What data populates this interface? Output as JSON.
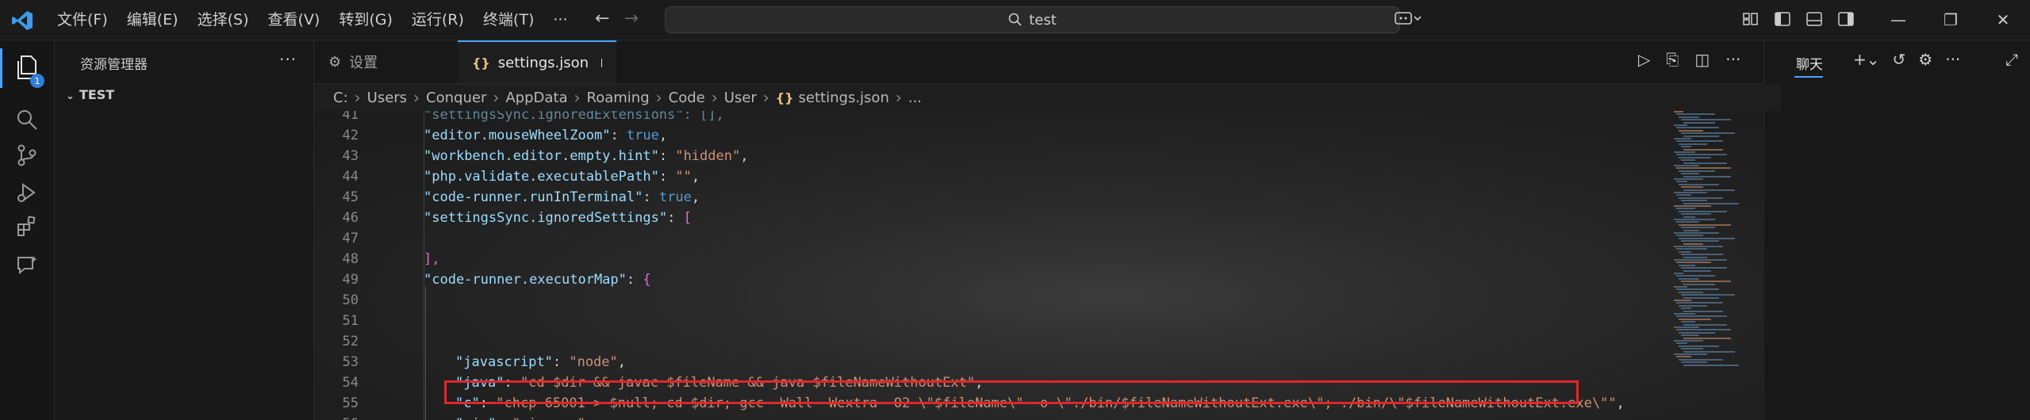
{
  "menu": [
    "文件(F)",
    "编辑(E)",
    "选择(S)",
    "查看(V)",
    "转到(G)",
    "运行(R)",
    "终端(T)",
    "···"
  ],
  "search": {
    "text": "test"
  },
  "activity_badge": "1",
  "sidebar": {
    "title": "资源管理器",
    "more": "···",
    "folder": "TEST"
  },
  "tabs": [
    {
      "label": "设置"
    },
    {
      "label": "settings.json"
    }
  ],
  "chat": {
    "title": "聊天"
  },
  "breadcrumb": [
    "C:",
    "Users",
    "Conquer",
    "AppData",
    "Roaming",
    "Code",
    "User",
    "settings.json",
    "..."
  ],
  "code_lines": [
    {
      "n": "41",
      "text": "\"settingsSync.ignoredExtensions\": [],"
    },
    {
      "n": "42",
      "k": "editor.mouseWheelZoom",
      "v": "true",
      "vt": "kw"
    },
    {
      "n": "43",
      "k": "workbench.editor.empty.hint",
      "v": "\"hidden\"",
      "vt": "str"
    },
    {
      "n": "44",
      "k": "php.validate.executablePath",
      "v": "\"\"",
      "vt": "str"
    },
    {
      "n": "45",
      "k": "code-runner.runInTerminal",
      "v": "true",
      "vt": "kw"
    },
    {
      "n": "46",
      "k": "settingsSync.ignoredSettings",
      "v": "[",
      "vt": "brk"
    },
    {
      "n": "47"
    },
    {
      "n": "48",
      "raw": "],"
    },
    {
      "n": "49",
      "k": "code-runner.executorMap",
      "v": "{",
      "vt": "brk"
    },
    {
      "n": "50"
    },
    {
      "n": "51"
    },
    {
      "n": "52"
    },
    {
      "n": "53",
      "k": "javascript",
      "v": "\"node\"",
      "vt": "str",
      "indent": 2
    },
    {
      "n": "54",
      "k": "java",
      "v": "\"cd $dir && javac $fileName && java $fileNameWithoutExt\"",
      "vt": "str",
      "indent": 2
    },
    {
      "n": "55",
      "k": "c",
      "v": "\"chcp 65001 > $null; cd $dir; gcc -Wall -Wextra -O2 \\\"$fileName\\\" -o \\\"./bin/$fileNameWithoutExt.exe\\\"; ./bin/\\\"$fileNameWithoutExt.exe\\\"\"",
      "vt": "str",
      "indent": 2
    },
    {
      "n": "56",
      "k": "zig",
      "v": "\"zig run\"",
      "vt": "str",
      "indent": 2
    }
  ]
}
